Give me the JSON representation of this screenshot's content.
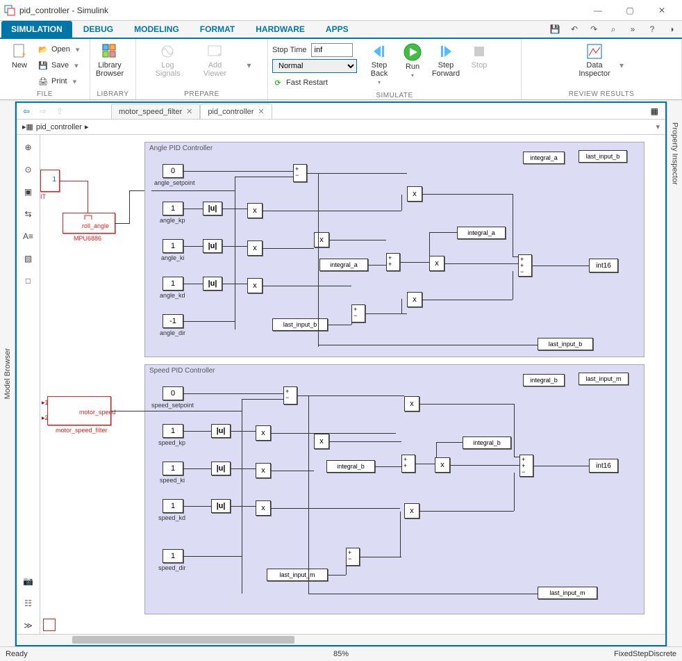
{
  "window": {
    "title": "pid_controller - Simulink",
    "min": "—",
    "max": "▢",
    "close": "✕"
  },
  "tabs": [
    "SIMULATION",
    "DEBUG",
    "MODELING",
    "FORMAT",
    "HARDWARE",
    "APPS"
  ],
  "active_tab": 0,
  "qat_tips": [
    "save",
    "undo",
    "redo",
    "search",
    "more",
    "help",
    "collapse"
  ],
  "ribbon": {
    "file": {
      "label": "FILE",
      "new": "New",
      "open": "Open",
      "save": "Save",
      "print": "Print"
    },
    "library": {
      "label": "LIBRARY",
      "btn": "Library\nBrowser"
    },
    "prepare": {
      "label": "PREPARE",
      "log": "Log\nSignals",
      "add": "Add\nViewer"
    },
    "simulate": {
      "label": "SIMULATE",
      "stoptime_lbl": "Stop Time",
      "stoptime_val": "inf",
      "mode": "Normal",
      "restart": "Fast Restart",
      "stepback": "Step\nBack",
      "run": "Run",
      "stepfwd": "Step\nForward",
      "stop": "Stop"
    },
    "review": {
      "label": "REVIEW RESULTS",
      "inspector": "Data\nInspector"
    }
  },
  "rails": {
    "left": "Model Browser",
    "right": "Property Inspector"
  },
  "nav": {
    "tabs": [
      {
        "label": "motor_speed_filter",
        "active": false
      },
      {
        "label": "pid_controller",
        "active": true
      }
    ],
    "crumb": "pid_controller",
    "chev": "▸"
  },
  "palette": [
    "⊕",
    "⊙",
    "▣",
    "⇆",
    "A≡",
    "▧",
    "□"
  ],
  "palette_bottom": [
    "📷",
    "☷",
    "≫"
  ],
  "status": {
    "left": "Ready",
    "mid": "85%",
    "right": "FixedStepDiscrete"
  },
  "diagram": {
    "red_block1_label": "IT",
    "mpu_port": "roll_angle",
    "mpu_label": "MPU6886",
    "msf_port": "motor_speed",
    "msf_label": "motor_speed_filter",
    "angle": {
      "title": "Angle PID Controller",
      "setpoint_val": "0",
      "setpoint_lbl": "angle_setpoint",
      "kp_val": "1",
      "kp_lbl": "angle_kp",
      "ki_val": "1",
      "ki_lbl": "angle_ki",
      "kd_val": "1",
      "kd_lbl": "angle_kd",
      "dir_val": "-1",
      "dir_lbl": "angle_dir",
      "abs": "|u|",
      "mul": "x",
      "integral_store": "integral_a",
      "integral_read": "integral_a",
      "last_store": "last_input_b",
      "last_read": "last_input_b",
      "out": "int16",
      "tag_int": "integral_a",
      "tag_last": "last_input_b"
    },
    "speed": {
      "title": "Speed PID Controller",
      "setpoint_val": "0",
      "setpoint_lbl": "speed_setpoint",
      "kp_val": "1",
      "kp_lbl": "speed_kp",
      "ki_val": "1",
      "ki_lbl": "speed_ki",
      "kd_val": "1",
      "kd_lbl": "speed_kd",
      "dir_val": "1",
      "dir_lbl": "speed_dir",
      "abs": "|u|",
      "mul": "x",
      "integral_store": "integral_b",
      "integral_read": "integral_b",
      "last_store": "last_input_m",
      "last_read": "last_input_m",
      "out": "int16",
      "tag_int": "integral_b",
      "tag_last": "last_input_m"
    }
  }
}
